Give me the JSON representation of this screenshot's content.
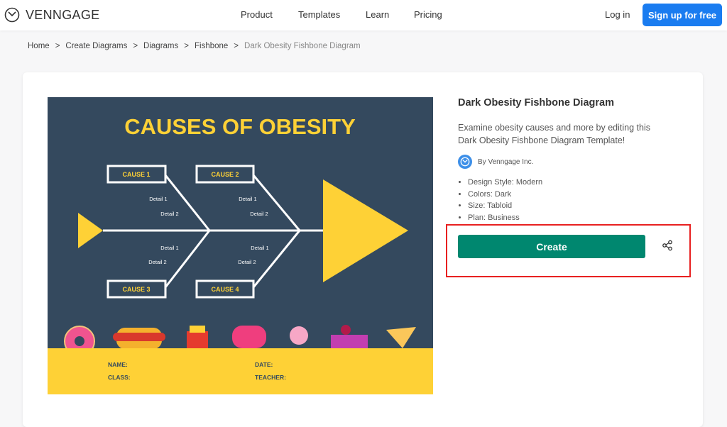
{
  "nav": {
    "brand": "VENNGAGE",
    "links": [
      "Product",
      "Templates",
      "Learn",
      "Pricing"
    ],
    "login": "Log in",
    "signup": "Sign up for free"
  },
  "breadcrumb": [
    "Home",
    "Create Diagrams",
    "Diagrams",
    "Fishbone",
    "Dark Obesity Fishbone Diagram"
  ],
  "template": {
    "heading": "CAUSES OF OBESITY",
    "causes": [
      "CAUSE 1",
      "CAUSE 2",
      "CAUSE 3",
      "CAUSE 4"
    ],
    "detail1": "Detail 1",
    "detail2": "Detail 2",
    "fields": {
      "name": "NAME:",
      "date": "DATE:",
      "class": "CLASS:",
      "teacher": "TEACHER:"
    },
    "colors": {
      "bg": "#34495e",
      "accent": "#fed136"
    }
  },
  "details": {
    "title": "Dark Obesity Fishbone Diagram",
    "description": "Examine obesity causes and more by editing this Dark Obesity Fishbone Diagram Template!",
    "author": "By Venngage Inc.",
    "properties": [
      "Design Style: Modern",
      "Colors: Dark",
      "Size: Tabloid",
      "Plan: Business"
    ],
    "create": "Create",
    "share_icon": "share-icon"
  }
}
